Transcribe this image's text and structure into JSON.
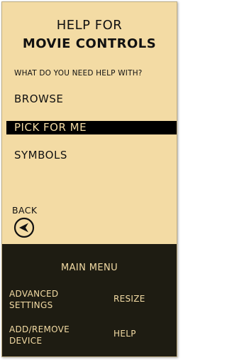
{
  "help": {
    "title_line1": "HELP FOR",
    "title_line2": "MOVIE CONTROLS",
    "prompt": "WHAT DO YOU NEED HELP WITH?",
    "options": [
      {
        "label": "BROWSE",
        "selected": false
      },
      {
        "label": "PICK FOR ME",
        "selected": true
      },
      {
        "label": "SYMBOLS",
        "selected": false
      }
    ],
    "back_label": "BACK",
    "back_icon": "back-arrow-icon"
  },
  "menu": {
    "title": "MAIN MENU",
    "items": [
      {
        "label": "ADVANCED\nSETTINGS"
      },
      {
        "label": "RESIZE"
      },
      {
        "label": "ADD/REMOVE\nDEVICE"
      },
      {
        "label": "HELP"
      }
    ]
  },
  "colors": {
    "panel_bg": "#f3dba4",
    "menu_bg": "#1e1c12",
    "highlight_bg": "#000000",
    "text_dark": "#111111",
    "text_light": "#f3dba4"
  }
}
